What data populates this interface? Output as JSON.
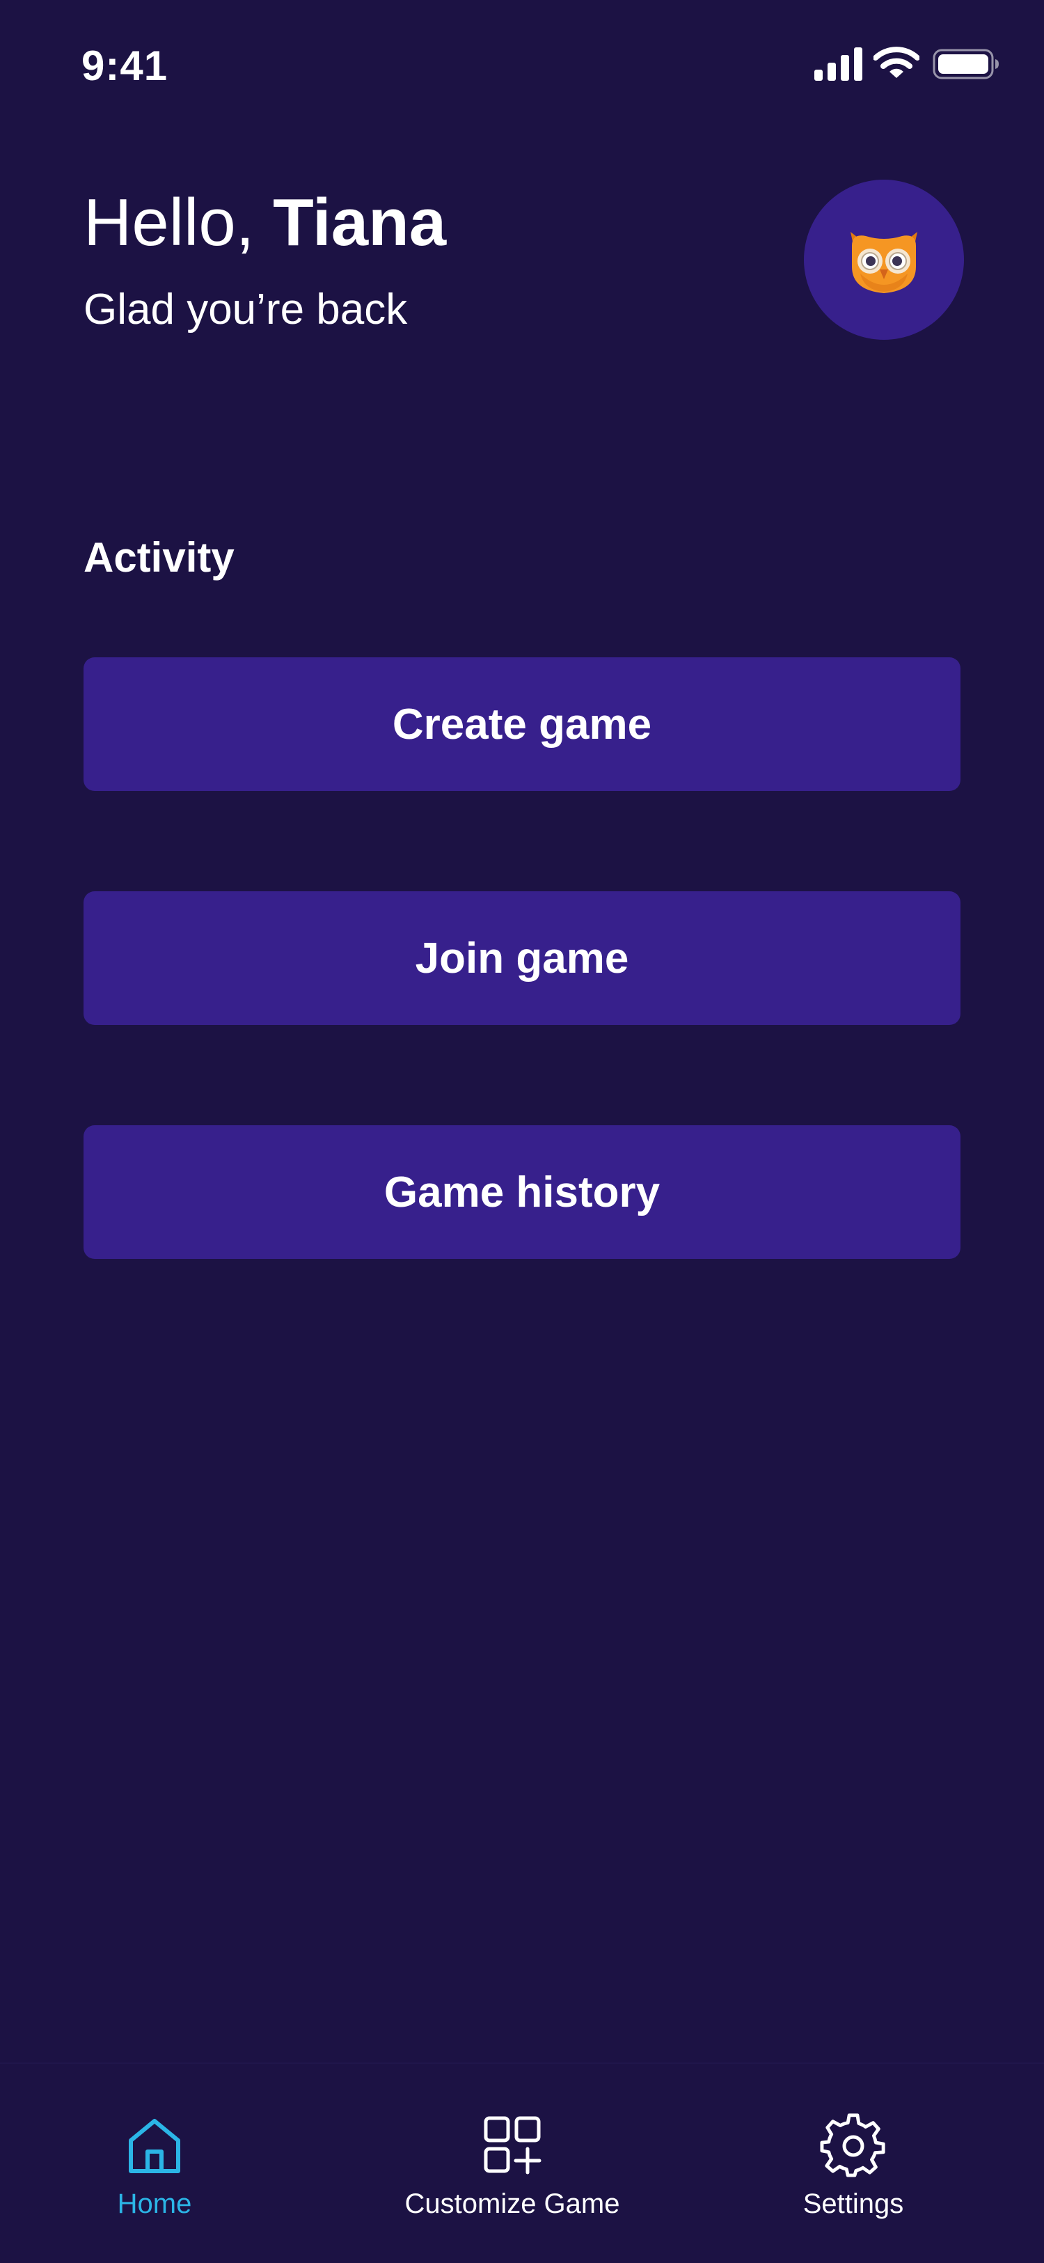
{
  "status_bar": {
    "time": "9:41"
  },
  "greeting": {
    "prefix": "Hello, ",
    "name": "Tiana",
    "subtitle": "Glad you’re back"
  },
  "avatar": {
    "icon": "owl-icon",
    "background": "#37208c"
  },
  "activity": {
    "title": "Activity",
    "buttons": [
      {
        "label": "Create game"
      },
      {
        "label": "Join game"
      },
      {
        "label": "Game history"
      }
    ]
  },
  "bottom_nav": {
    "items": [
      {
        "label": "Home",
        "icon": "home-icon",
        "active": true
      },
      {
        "label": "Customize Game",
        "icon": "grid-add-icon",
        "active": false
      },
      {
        "label": "Settings",
        "icon": "gear-icon",
        "active": false
      }
    ]
  },
  "colors": {
    "background": "#1c1244",
    "button": "#37208c",
    "accent": "#2bb5e6",
    "text": "#ffffff"
  }
}
